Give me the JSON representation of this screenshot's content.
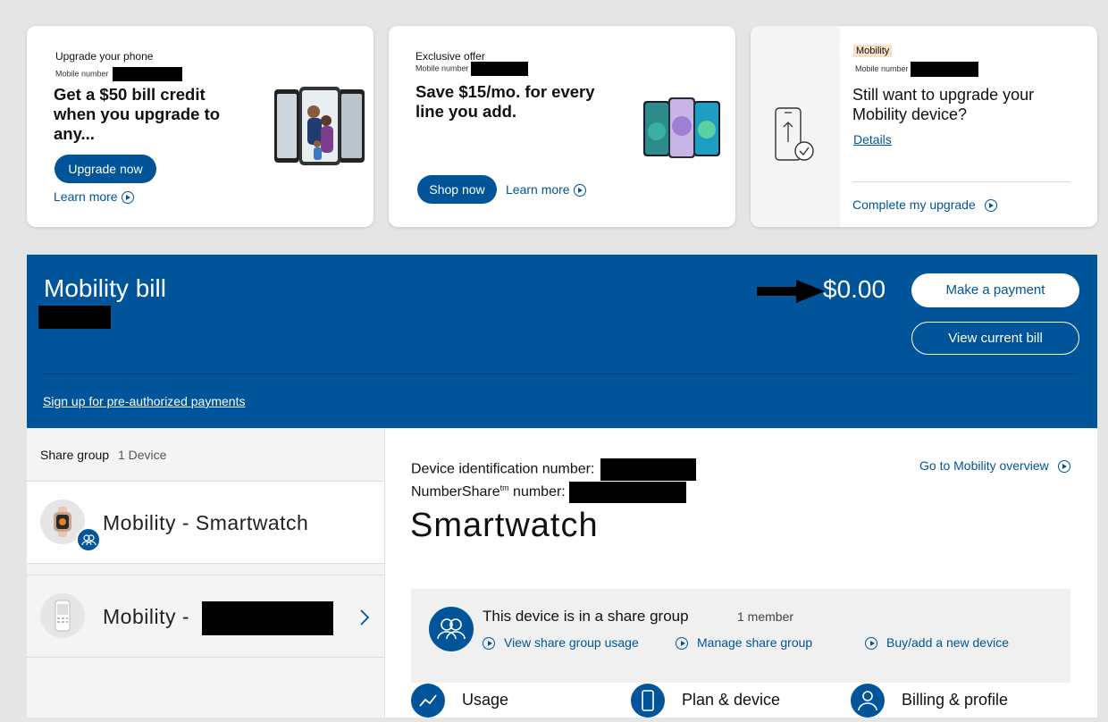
{
  "offers": [
    {
      "eyebrow": "Upgrade your phone",
      "mobile_label": "Mobile number",
      "headline": "Get a $50 bill credit when you upgrade to any...",
      "button": "Upgrade now",
      "link": "Learn more"
    },
    {
      "eyebrow": "Exclusive offer",
      "mobile_label": "Mobile number",
      "headline": "Save $15/mo. for every line you add.",
      "button": "Shop now",
      "link": "Learn more"
    },
    {
      "badge": "Mobility",
      "mobile_label": "Mobile number",
      "headline": "Still want to upgrade your Mobility device?",
      "details": "Details",
      "link": "Complete my upgrade"
    }
  ],
  "bill": {
    "title": "Mobility bill",
    "amount": "$0.00",
    "make_payment": "Make a payment",
    "view_bill": "View current bill",
    "preauth_link": "Sign up for pre-authorized payments"
  },
  "sidebar": {
    "share_group_label": "Share group",
    "device_count": "1 Device",
    "items": [
      {
        "label": "Mobility - Smartwatch"
      },
      {
        "label": "Mobility -"
      }
    ]
  },
  "device": {
    "id_label": "Device identification number:",
    "numbershare_label": "NumberShare",
    "numbershare_tm": "tm",
    "numbershare_suffix": " number:",
    "title": "Smartwatch",
    "overview_link": "Go to Mobility overview"
  },
  "share_box": {
    "title": "This device is in a share group",
    "members": "1 member",
    "links": [
      "View share group usage",
      "Manage share group",
      "Buy/add a new device"
    ]
  },
  "bottom_tabs": [
    "Usage",
    "Plan & device",
    "Billing & profile"
  ],
  "colors": {
    "brand_blue": "#00549a",
    "badge_bg": "#f7e2c6",
    "background": "#e5e5e5"
  }
}
